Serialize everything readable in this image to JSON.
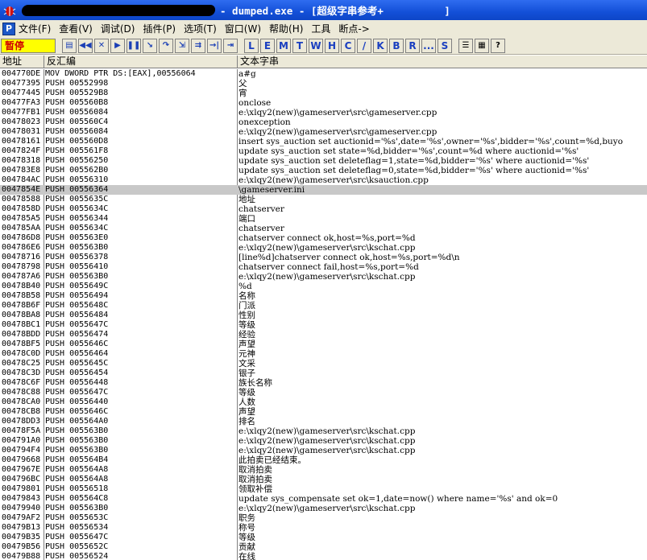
{
  "window": {
    "title": "- dumped.exe - [超级字串参考+          ]"
  },
  "menu": {
    "badge": "P",
    "items": [
      "文件(F)",
      "查看(V)",
      "调试(D)",
      "插件(P)",
      "选项(T)",
      "窗口(W)",
      "帮助(H)",
      "工具",
      "断点->"
    ]
  },
  "toolbar": {
    "status": "暂停",
    "buttons": [
      {
        "name": "open-icon",
        "glyph": "▤"
      },
      {
        "name": "rewind-icon",
        "glyph": "◀◀"
      },
      {
        "name": "close-icon",
        "glyph": "✕"
      },
      {
        "name": "run-icon",
        "glyph": "▶"
      },
      {
        "name": "pause-icon",
        "glyph": "❚❚"
      },
      {
        "name": "step-into-icon",
        "glyph": "↘"
      },
      {
        "name": "step-over-icon",
        "glyph": "↷"
      },
      {
        "name": "trace-into-icon",
        "glyph": "⇲"
      },
      {
        "name": "trace-over-icon",
        "glyph": "⇉"
      },
      {
        "name": "execute-till-return-icon",
        "glyph": "→|"
      },
      {
        "name": "goto-icon",
        "glyph": "⇥"
      }
    ],
    "letters": [
      "L",
      "E",
      "M",
      "T",
      "W",
      "H",
      "C",
      "/",
      "K",
      "B",
      "R",
      "...",
      "S"
    ],
    "extra_buttons": [
      {
        "name": "list-icon",
        "glyph": "☰"
      },
      {
        "name": "grid-icon",
        "glyph": "▦"
      },
      {
        "name": "help-icon",
        "glyph": "?"
      }
    ]
  },
  "columns": {
    "address": "地址",
    "disassembly": "反汇编",
    "text": "文本字串"
  },
  "rows": [
    {
      "addr": "004770DE",
      "disasm": "MOV DWORD PTR DS:[EAX],00556064",
      "text": "a#g"
    },
    {
      "addr": "00477395",
      "disasm": "PUSH 00552998",
      "text": "父"
    },
    {
      "addr": "00477445",
      "disasm": "PUSH 005529B8",
      "text": "宵"
    },
    {
      "addr": "00477FA3",
      "disasm": "PUSH 005560B8",
      "text": "onclose"
    },
    {
      "addr": "00477FB1",
      "disasm": "PUSH 00556084",
      "text": "e:\\xlqy2(new)\\gameserver\\src\\gameserver.cpp"
    },
    {
      "addr": "00478023",
      "disasm": "PUSH 005560C4",
      "text": "onexception"
    },
    {
      "addr": "00478031",
      "disasm": "PUSH 00556084",
      "text": "e:\\xlqy2(new)\\gameserver\\src\\gameserver.cpp"
    },
    {
      "addr": "00478161",
      "disasm": "PUSH 005560D8",
      "text": "insert sys_auction set auctionid='%s',date='%s',owner='%s',bidder='%s',count=%d,buyo"
    },
    {
      "addr": "0047824F",
      "disasm": "PUSH 005561F8",
      "text": "update sys_auction set state=%d,bidder='%s',count=%d where auctionid='%s'"
    },
    {
      "addr": "00478318",
      "disasm": "PUSH 00556250",
      "text": "update sys_auction set deleteflag=1,state=%d,bidder='%s' where auctionid='%s'"
    },
    {
      "addr": "004783E8",
      "disasm": "PUSH 005562B0",
      "text": "update sys_auction set deleteflag=0,state=%d,bidder='%s' where auctionid='%s'"
    },
    {
      "addr": "004784AC",
      "disasm": "PUSH 00556310",
      "text": "e:\\xlqy2(new)\\gameserver\\src\\ksauction.cpp"
    },
    {
      "addr": "0047854E",
      "disasm": "PUSH 00556364",
      "text": "\\gameserver.ini",
      "selected": true
    },
    {
      "addr": "00478588",
      "disasm": "PUSH 0055635C",
      "text": "地址"
    },
    {
      "addr": "0047858D",
      "disasm": "PUSH 0055634C",
      "text": "chatserver"
    },
    {
      "addr": "004785A5",
      "disasm": "PUSH 00556344",
      "text": "端口"
    },
    {
      "addr": "004785AA",
      "disasm": "PUSH 0055634C",
      "text": "chatserver"
    },
    {
      "addr": "004786D8",
      "disasm": "PUSH 005563E0",
      "text": "chatserver connect ok,host=%s,port=%d"
    },
    {
      "addr": "004786E6",
      "disasm": "PUSH 005563B0",
      "text": "e:\\xlqy2(new)\\gameserver\\src\\kschat.cpp"
    },
    {
      "addr": "00478716",
      "disasm": "PUSH 00556378",
      "text": "[line%d]chatserver connect ok,host=%s,port=%d\\n"
    },
    {
      "addr": "00478798",
      "disasm": "PUSH 00556410",
      "text": "chatserver connect fail,host=%s,port=%d"
    },
    {
      "addr": "004787A6",
      "disasm": "PUSH 005563B0",
      "text": "e:\\xlqy2(new)\\gameserver\\src\\kschat.cpp"
    },
    {
      "addr": "00478B40",
      "disasm": "PUSH 0055649C",
      "text": "%d"
    },
    {
      "addr": "00478B58",
      "disasm": "PUSH 00556494",
      "text": "名称"
    },
    {
      "addr": "00478B6F",
      "disasm": "PUSH 0055648C",
      "text": "门派"
    },
    {
      "addr": "00478BA8",
      "disasm": "PUSH 00556484",
      "text": "性别"
    },
    {
      "addr": "00478BC1",
      "disasm": "PUSH 0055647C",
      "text": "等级"
    },
    {
      "addr": "00478BDD",
      "disasm": "PUSH 00556474",
      "text": "经验"
    },
    {
      "addr": "00478BF5",
      "disasm": "PUSH 0055646C",
      "text": "声望"
    },
    {
      "addr": "00478C0D",
      "disasm": "PUSH 00556464",
      "text": "元神"
    },
    {
      "addr": "00478C25",
      "disasm": "PUSH 0055645C",
      "text": "文采"
    },
    {
      "addr": "00478C3D",
      "disasm": "PUSH 00556454",
      "text": "银子"
    },
    {
      "addr": "00478C6F",
      "disasm": "PUSH 00556448",
      "text": "族长名称"
    },
    {
      "addr": "00478C88",
      "disasm": "PUSH 0055647C",
      "text": "等级"
    },
    {
      "addr": "00478CA0",
      "disasm": "PUSH 00556440",
      "text": "人数"
    },
    {
      "addr": "00478CB8",
      "disasm": "PUSH 0055646C",
      "text": "声望"
    },
    {
      "addr": "00478DD3",
      "disasm": "PUSH 005564A0",
      "text": "排名"
    },
    {
      "addr": "00478F5A",
      "disasm": "PUSH 005563B0",
      "text": "e:\\xlqy2(new)\\gameserver\\src\\kschat.cpp"
    },
    {
      "addr": "004791A0",
      "disasm": "PUSH 005563B0",
      "text": "e:\\xlqy2(new)\\gameserver\\src\\kschat.cpp"
    },
    {
      "addr": "004794F4",
      "disasm": "PUSH 005563B0",
      "text": "e:\\xlqy2(new)\\gameserver\\src\\kschat.cpp"
    },
    {
      "addr": "00479668",
      "disasm": "PUSH 005564B4",
      "text": "此拍卖已经结束。"
    },
    {
      "addr": "0047967E",
      "disasm": "PUSH 005564A8",
      "text": "取消拍卖"
    },
    {
      "addr": "004796BC",
      "disasm": "PUSH 005564A8",
      "text": "取消拍卖"
    },
    {
      "addr": "00479801",
      "disasm": "PUSH 00556518",
      "text": "领取补偿"
    },
    {
      "addr": "00479843",
      "disasm": "PUSH 005564C8",
      "text": "update sys_compensate set ok=1,date=now() where name='%s' and ok=0"
    },
    {
      "addr": "00479940",
      "disasm": "PUSH 005563B0",
      "text": "e:\\xlqy2(new)\\gameserver\\src\\kschat.cpp"
    },
    {
      "addr": "00479AF2",
      "disasm": "PUSH 0055653C",
      "text": "职务"
    },
    {
      "addr": "00479B13",
      "disasm": "PUSH 00556534",
      "text": "称号"
    },
    {
      "addr": "00479B35",
      "disasm": "PUSH 0055647C",
      "text": "等级"
    },
    {
      "addr": "00479B56",
      "disasm": "PUSH 0055652C",
      "text": "贡献"
    },
    {
      "addr": "00479B88",
      "disasm": "PUSH 00556524",
      "text": "在线"
    }
  ]
}
